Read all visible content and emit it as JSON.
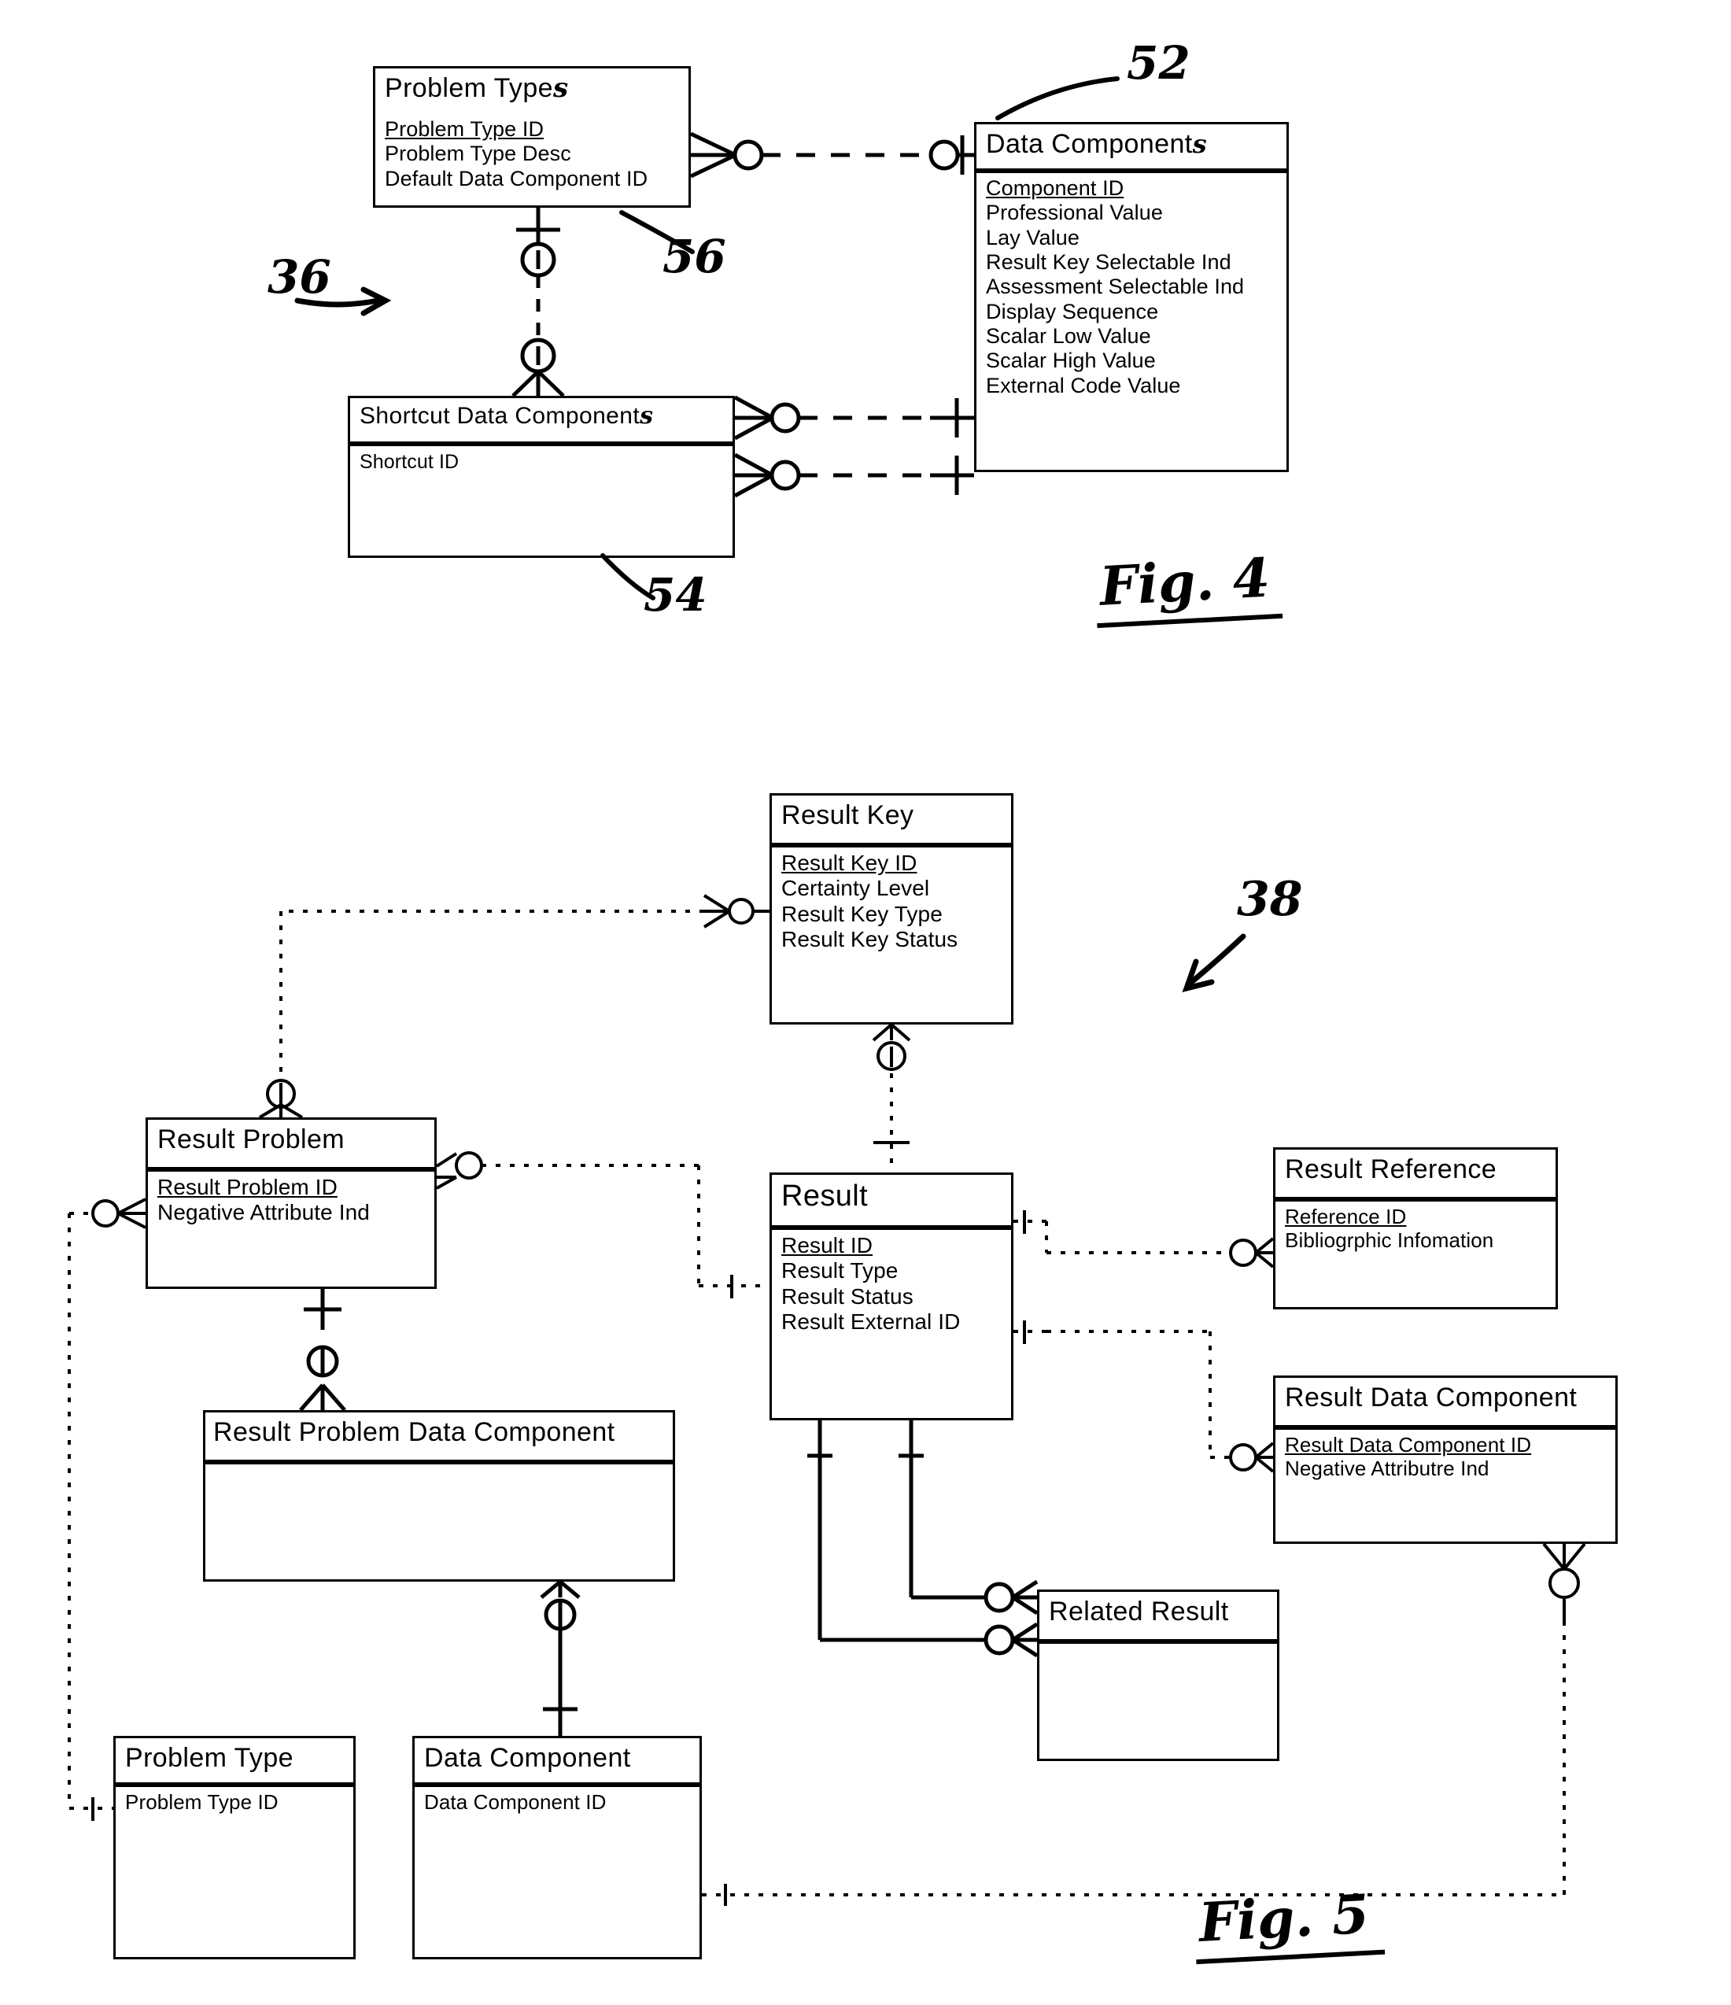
{
  "figures": [
    {
      "id": "fig4",
      "figure_label": "Fig. 4",
      "diagram_ref": "36",
      "callouts": [
        {
          "ref": "52",
          "points_to": "Data Components"
        },
        {
          "ref": "56",
          "points_to": "Problem Types"
        },
        {
          "ref": "54",
          "points_to": "Shortcut Data Components"
        }
      ],
      "entities": [
        {
          "name": "Problem Types",
          "title_printed": "Problem Type",
          "title_handwritten_suffix": "s",
          "attributes": [
            {
              "label": "Problem Type ID",
              "key": true
            },
            {
              "label": "Problem Type Desc",
              "key": false
            },
            {
              "label": "Default Data Component ID",
              "key": false
            }
          ]
        },
        {
          "name": "Data Components",
          "title_printed": "Data Component",
          "title_handwritten_suffix": "s",
          "attributes": [
            {
              "label": "Component ID",
              "key": true
            },
            {
              "label": "Professional Value",
              "key": false
            },
            {
              "label": "Lay Value",
              "key": false
            },
            {
              "label": "Result Key Selectable Ind",
              "key": false
            },
            {
              "label": "Assessment Selectable Ind",
              "key": false
            },
            {
              "label": "Display Sequence",
              "key": false
            },
            {
              "label": "Scalar Low Value",
              "key": false
            },
            {
              "label": "Scalar High Value",
              "key": false
            },
            {
              "label": "External Code Value",
              "key": false
            }
          ]
        },
        {
          "name": "Shortcut Data Components",
          "title_printed": "Shortcut Data Component",
          "title_handwritten_suffix": "s",
          "attributes": [
            {
              "label": "Shortcut ID",
              "key": false
            }
          ]
        }
      ],
      "relationships": [
        {
          "from": "Problem Types",
          "to": "Data Components",
          "style": "dashed",
          "from_card": "zero-or-many",
          "to_card": "exactly-one"
        },
        {
          "from": "Problem Types",
          "to": "Shortcut Data Components",
          "style": "dashed",
          "from_card": "one-optional",
          "to_card": "zero-or-many"
        },
        {
          "from": "Shortcut Data Components",
          "to": "Data Components",
          "style": "dashed",
          "from_card": "zero-or-many",
          "to_card": "exactly-one"
        },
        {
          "from": "Shortcut Data Components",
          "to": "Data Components",
          "style": "dashed",
          "from_card": "zero-or-many",
          "to_card": "exactly-one"
        }
      ]
    },
    {
      "id": "fig5",
      "figure_label": "Fig. 5",
      "diagram_ref": "38",
      "callouts": [],
      "entities": [
        {
          "name": "Result Key",
          "title_printed": "Result Key",
          "title_handwritten_suffix": "",
          "attributes": [
            {
              "label": "Result Key ID",
              "key": true
            },
            {
              "label": "Certainty Level",
              "key": false
            },
            {
              "label": "Result Key Type",
              "key": false
            },
            {
              "label": "Result Key Status",
              "key": false
            }
          ]
        },
        {
          "name": "Result Problem",
          "title_printed": "Result Problem",
          "title_handwritten_suffix": "",
          "attributes": [
            {
              "label": "Result Problem ID",
              "key": true
            },
            {
              "label": "Negative Attribute Ind",
              "key": false
            }
          ]
        },
        {
          "name": "Result",
          "title_printed": "Result",
          "title_handwritten_suffix": "",
          "attributes": [
            {
              "label": "Result ID",
              "key": true
            },
            {
              "label": "Result Type",
              "key": false
            },
            {
              "label": "Result Status",
              "key": false
            },
            {
              "label": "Result External ID",
              "key": false
            }
          ]
        },
        {
          "name": "Result Reference",
          "title_printed": "Result Reference",
          "title_handwritten_suffix": "",
          "attributes": [
            {
              "label": "Reference ID",
              "key": true
            },
            {
              "label": "Bibliogrphic Infomation",
              "key": false
            }
          ]
        },
        {
          "name": "Result Data Component",
          "title_printed": "Result Data Component",
          "title_handwritten_suffix": "",
          "attributes": [
            {
              "label": "Result Data Component ID",
              "key": true
            },
            {
              "label": "Negative Attributre Ind",
              "key": false
            }
          ]
        },
        {
          "name": "Result Problem Data Component",
          "title_printed": "Result Problem Data Component",
          "title_handwritten_suffix": "",
          "attributes": []
        },
        {
          "name": "Related Result",
          "title_printed": "Related Result",
          "title_handwritten_suffix": "",
          "attributes": []
        },
        {
          "name": "Problem Type",
          "title_printed": "Problem Type",
          "title_handwritten_suffix": "",
          "attributes": [
            {
              "label": "Problem Type ID",
              "key": false
            }
          ]
        },
        {
          "name": "Data Component",
          "title_printed": "Data Component",
          "title_handwritten_suffix": "",
          "attributes": [
            {
              "label": "Data Component ID",
              "key": false
            }
          ]
        }
      ],
      "relationships": [
        {
          "from": "Result Key",
          "to": "Result",
          "style": "dotted",
          "from_card": "zero-or-many",
          "to_card": "exactly-one"
        },
        {
          "from": "Result Key",
          "to": "Result Problem",
          "style": "dotted",
          "from_card": "zero-or-many",
          "to_card": "zero-or-many"
        },
        {
          "from": "Result Problem",
          "to": "Result",
          "style": "dotted",
          "from_card": "zero-or-many",
          "to_card": "exactly-one"
        },
        {
          "from": "Result",
          "to": "Result Reference",
          "style": "dotted",
          "from_card": "exactly-one",
          "to_card": "zero-or-many"
        },
        {
          "from": "Result",
          "to": "Result Data Component",
          "style": "dotted",
          "from_card": "exactly-one",
          "to_card": "zero-or-many"
        },
        {
          "from": "Result",
          "to": "Related Result",
          "style": "solid",
          "from_card": "exactly-one",
          "to_card": "zero-or-many"
        },
        {
          "from": "Result",
          "to": "Related Result",
          "style": "solid",
          "from_card": "exactly-one",
          "to_card": "zero-or-many"
        },
        {
          "from": "Result Problem",
          "to": "Result Problem Data Component",
          "style": "solid",
          "from_card": "exactly-one",
          "to_card": "zero-or-many"
        },
        {
          "from": "Result Problem Data Component",
          "to": "Data Component",
          "style": "solid",
          "from_card": "zero-or-many",
          "to_card": "exactly-one"
        },
        {
          "from": "Problem Type",
          "to": "Result Problem",
          "style": "dotted",
          "from_card": "exactly-one",
          "to_card": "zero-or-many"
        },
        {
          "from": "Data Component",
          "to": "Result Data Component",
          "style": "dotted",
          "from_card": "exactly-one",
          "to_card": "zero-or-many"
        }
      ]
    }
  ]
}
